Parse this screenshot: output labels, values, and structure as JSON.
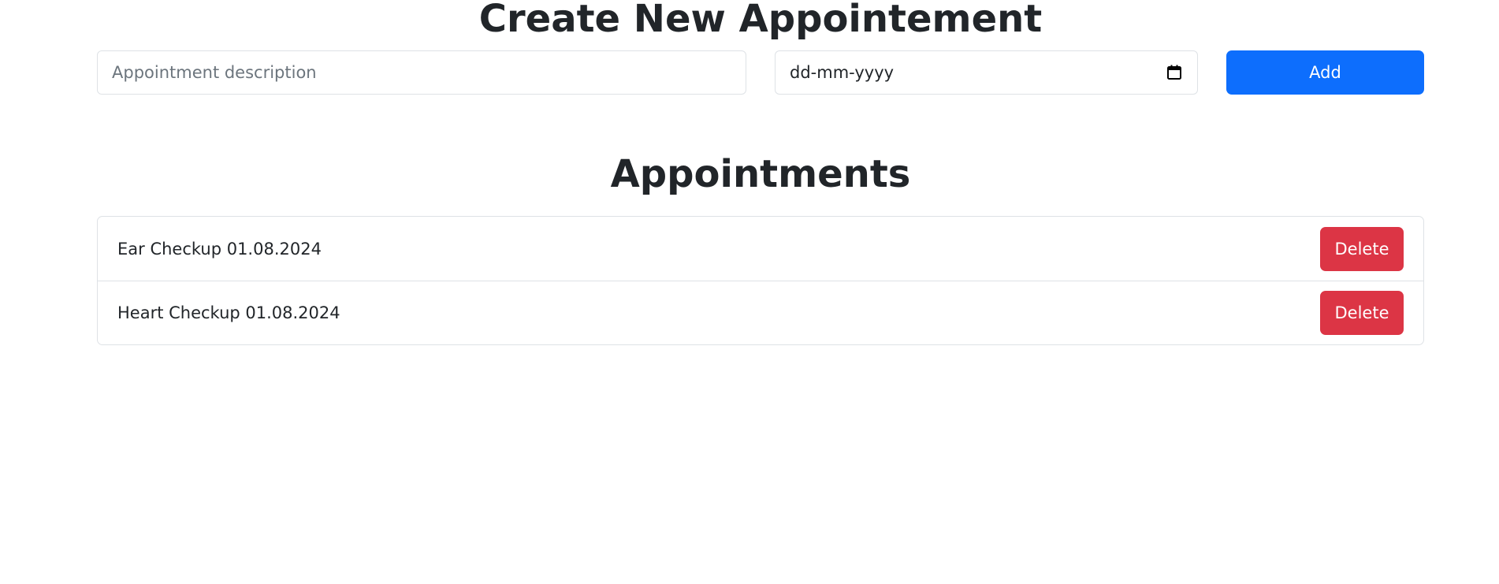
{
  "create_section": {
    "title": "Create New Appointement",
    "description_input": {
      "value": "",
      "placeholder": "Appointment description"
    },
    "date_input": {
      "value": "dd-mm-yyyy",
      "icon": "calendar-icon"
    },
    "add_label": "Add"
  },
  "appointments_section": {
    "title": "Appointments",
    "items": [
      {
        "text": "Ear Checkup 01.08.2024",
        "delete_label": "Delete"
      },
      {
        "text": "Heart Checkup 01.08.2024",
        "delete_label": "Delete"
      }
    ]
  },
  "colors": {
    "primary": "#0d6efd",
    "danger": "#dc3545",
    "text": "#212529",
    "border": "#dee2e6"
  }
}
